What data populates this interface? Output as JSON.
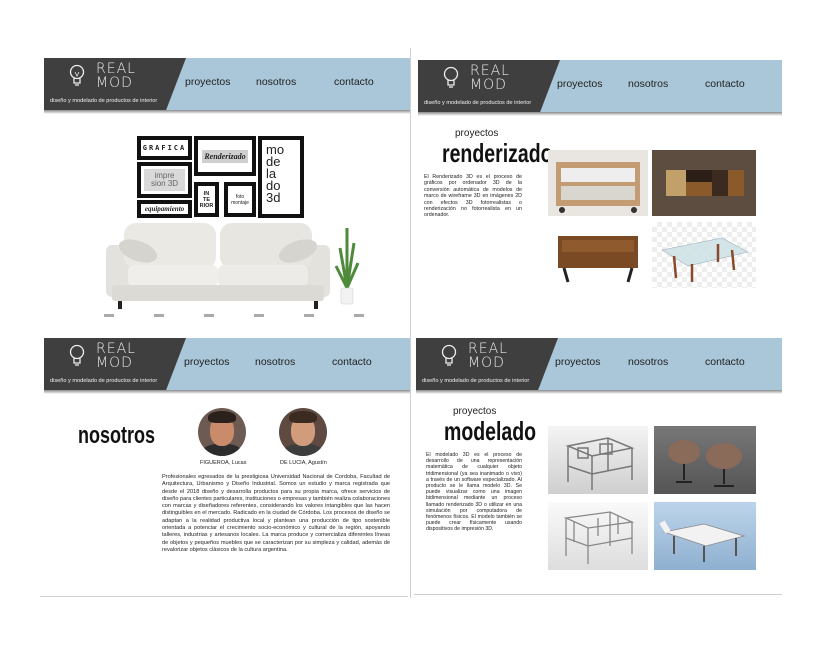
{
  "brand": {
    "logo_word": "REAL MOD",
    "tagline": "diseño y modelado de productos de interior"
  },
  "nav": {
    "proyectos": "proyectos",
    "nosotros": "nosotros",
    "contacto": "contacto"
  },
  "home": {
    "frames": {
      "grafica": "GRAFICA",
      "renderizado": "Renderizado",
      "impresion": "impre sion 3D",
      "interior": "IN TE RIOR",
      "foto": "foto montaje",
      "equipamiento": "equipamiento",
      "modelado": "mo de la do 3d"
    }
  },
  "renderizado": {
    "kicker": "proyectos",
    "title": "renderizado",
    "text": "El Renderizado 3D es el proceso de gráficos por ordenador 3D de la conversión automática de modelos de marco de wireframe 3D en imágenes 2D con efectos 3D fotorrealistas o renderización no fotorrealista en un ordenador."
  },
  "nosotros": {
    "title": "nosotros",
    "person1": "FIGUEROA, Lucas",
    "person2": "DE LUCIA, Agustín",
    "text": "Profesionales egresados de la prestigiosa Universidad Nacional de Cordoba, Facultad de Arquitectura, Urbanismo y Diseño Industrial. Somos un estudio y marca registrada que desde el 2018 diseño y desarrolla productos para su propia marca, ofrece servicios de diseño para clientes particulares, instituciones o empresas y también realiza colaboraciones con marcas y diseñadores referentes, considerando los valores intangibles que las hacen distinguibles en el mercado. Radicado en la ciudad de Córdoba. Los procesos de diseño se adaptan a la realidad productiva local y plantean una producción de tipo sostenible orientada a potenciar el crecimiento socio-económico y cultural de la región, apoyando talleres, industrias y artesanos locales. La marca produce y comercializa diferentes líneas de objetos y pequeños muebles que se caracterizan por su simpleza y calidad, además de revalorizar objetos clásicos de la cultura argentina."
  },
  "modelado": {
    "kicker": "proyectos",
    "title": "modelado",
    "text": "El modelado 3D es el proceso de desarrollo de una representación matemática de cualquier objeto tridimensional (ya sea inanimado o vivo) a través de un software especializado. Al producto se le llama modelo 3D. Se puede visualizar como una imagen bidimensional mediante un proceso llamado renderizado 3D o utilizar en una simulación por computadora de fenómenos físicos. El modelo también se puede crear físicamente usando dispositivos de impresión 3D."
  },
  "colors": {
    "header_blue": "#a9c7d8",
    "header_dark": "#3f3f3f"
  }
}
